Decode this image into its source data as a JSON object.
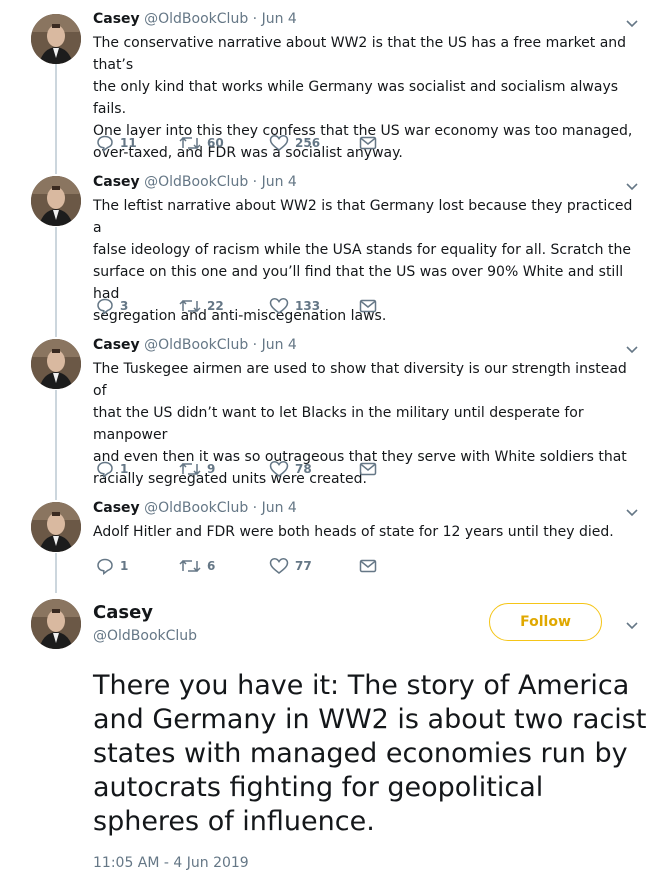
{
  "tweets": [
    {
      "name": "Casey",
      "handle": "@OldBookClub",
      "sep": "·",
      "date": "Jun 4",
      "lines": [
        "The conservative narrative about WW2 is that the US has a free market and that’s",
        "the only kind that works while Germany was socialist and socialism always fails.",
        "One layer into this they confess that the US war economy was too managed,",
        "over-taxed, and FDR was a socialist anyway."
      ],
      "replies": "11",
      "retweets": "60",
      "likes": "256"
    },
    {
      "name": "Casey",
      "handle": "@OldBookClub",
      "sep": "·",
      "date": "Jun 4",
      "lines": [
        "The leftist narrative about WW2 is that Germany lost because they practiced a",
        "false ideology of racism while the USA stands for equality for all. Scratch the",
        "surface on this one and you’ll find that the US was over 90% White and still had",
        "segregation and anti-miscegenation laws."
      ],
      "replies": "3",
      "retweets": "22",
      "likes": "133"
    },
    {
      "name": "Casey",
      "handle": "@OldBookClub",
      "sep": "·",
      "date": "Jun 4",
      "lines": [
        "The Tuskegee airmen are used to show that diversity is our strength instead of",
        "that the US didn’t want to let Blacks in the military until desperate for manpower",
        "and even then it was so outrageous that they serve with White soldiers that",
        "racially segregated units were created."
      ],
      "replies": "1",
      "retweets": "9",
      "likes": "78"
    },
    {
      "name": "Casey",
      "handle": "@OldBookClub",
      "sep": "·",
      "date": "Jun 4",
      "lines": [
        "Adolf Hitler and FDR were both heads of state for 12 years until they died."
      ],
      "replies": "1",
      "retweets": "6",
      "likes": "77"
    }
  ],
  "main": {
    "name": "Casey",
    "handle": "@OldBookClub",
    "follow_label": "Follow",
    "lines": [
      "There you have it: The story of America",
      "and Germany in WW2 is about two racist",
      "states with managed economies run by",
      "autocrats fighting for geopolitical",
      "spheres of influence."
    ],
    "timestamp": "11:05 AM - 4 Jun 2019"
  },
  "colors": {
    "link_gold": "#e0a800",
    "muted": "#657786",
    "thread_line": "#ccd6dd"
  },
  "icons": [
    "reply-icon",
    "retweet-icon",
    "like-icon",
    "dm-icon",
    "chevron-down-icon"
  ]
}
